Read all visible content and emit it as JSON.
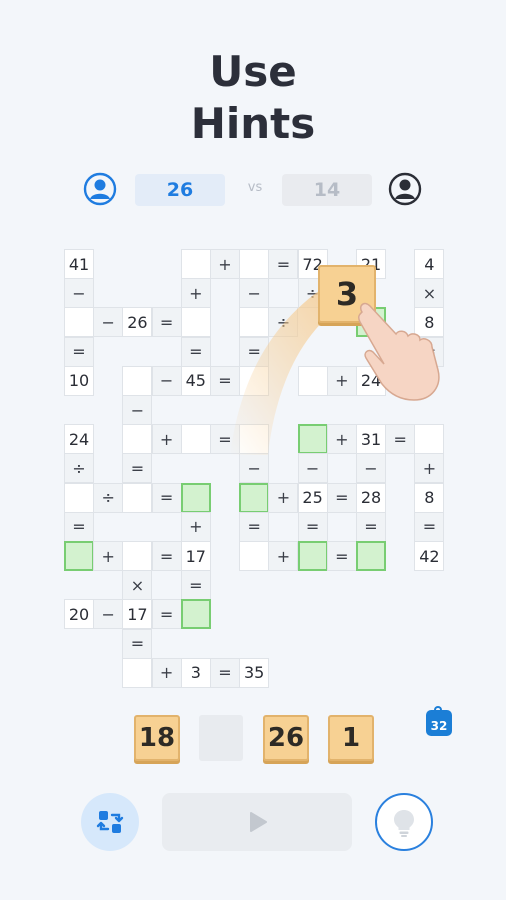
{
  "title": {
    "line1": "Use",
    "line2": "Hints"
  },
  "players": {
    "left_score": "26",
    "vs_label": "vs",
    "right_score": "14",
    "left_avatar_icon": "user-circle-icon",
    "right_avatar_icon": "user-circle-icon"
  },
  "colors": {
    "accent": "#1f7ce0",
    "tile": "#f7d193",
    "green_cell": "#d3f2cf",
    "background": "#f3f6fa"
  },
  "board": {
    "cells": [
      {
        "row": 0,
        "col": 0,
        "text": "41",
        "type": "num"
      },
      {
        "row": 0,
        "col": 4,
        "text": "",
        "type": "num"
      },
      {
        "row": 0,
        "col": 5,
        "text": "+",
        "type": "op"
      },
      {
        "row": 0,
        "col": 6,
        "text": "",
        "type": "num"
      },
      {
        "row": 0,
        "col": 7,
        "text": "=",
        "type": "op"
      },
      {
        "row": 0,
        "col": 8,
        "text": "72",
        "type": "num"
      },
      {
        "row": 0,
        "col": 10,
        "text": "21",
        "type": "num"
      },
      {
        "row": 0,
        "col": 12,
        "text": "4",
        "type": "num"
      },
      {
        "row": 1,
        "col": 0,
        "text": "−",
        "type": "op"
      },
      {
        "row": 1,
        "col": 4,
        "text": "+",
        "type": "op"
      },
      {
        "row": 1,
        "col": 6,
        "text": "−",
        "type": "op"
      },
      {
        "row": 1,
        "col": 8,
        "text": "÷",
        "type": "op"
      },
      {
        "row": 1,
        "col": 12,
        "text": "×",
        "type": "op"
      },
      {
        "row": 2,
        "col": 0,
        "text": "",
        "type": "num"
      },
      {
        "row": 2,
        "col": 1,
        "text": "−",
        "type": "op"
      },
      {
        "row": 2,
        "col": 2,
        "text": "26",
        "type": "num"
      },
      {
        "row": 2,
        "col": 3,
        "text": "=",
        "type": "op"
      },
      {
        "row": 2,
        "col": 4,
        "text": "",
        "type": "num"
      },
      {
        "row": 2,
        "col": 6,
        "text": "",
        "type": "num"
      },
      {
        "row": 2,
        "col": 7,
        "text": "÷",
        "type": "op"
      },
      {
        "row": 2,
        "col": 10,
        "text": "",
        "type": "green"
      },
      {
        "row": 2,
        "col": 12,
        "text": "8",
        "type": "num"
      },
      {
        "row": 3,
        "col": 0,
        "text": "=",
        "type": "op"
      },
      {
        "row": 3,
        "col": 4,
        "text": "=",
        "type": "op"
      },
      {
        "row": 3,
        "col": 6,
        "text": "=",
        "type": "op"
      },
      {
        "row": 3,
        "col": 12,
        "text": "=",
        "type": "op"
      },
      {
        "row": 4,
        "col": 0,
        "text": "10",
        "type": "num"
      },
      {
        "row": 4,
        "col": 2,
        "text": "",
        "type": "num"
      },
      {
        "row": 4,
        "col": 3,
        "text": "−",
        "type": "op"
      },
      {
        "row": 4,
        "col": 4,
        "text": "45",
        "type": "num"
      },
      {
        "row": 4,
        "col": 5,
        "text": "=",
        "type": "op"
      },
      {
        "row": 4,
        "col": 6,
        "text": "",
        "type": "num"
      },
      {
        "row": 4,
        "col": 8,
        "text": "",
        "type": "num"
      },
      {
        "row": 4,
        "col": 9,
        "text": "+",
        "type": "op"
      },
      {
        "row": 4,
        "col": 10,
        "text": "24",
        "type": "num"
      },
      {
        "row": 5,
        "col": 2,
        "text": "−",
        "type": "op"
      },
      {
        "row": 6,
        "col": 0,
        "text": "24",
        "type": "num"
      },
      {
        "row": 6,
        "col": 2,
        "text": "",
        "type": "num"
      },
      {
        "row": 6,
        "col": 3,
        "text": "+",
        "type": "op"
      },
      {
        "row": 6,
        "col": 4,
        "text": "",
        "type": "num"
      },
      {
        "row": 6,
        "col": 5,
        "text": "=",
        "type": "op"
      },
      {
        "row": 6,
        "col": 6,
        "text": "",
        "type": "num"
      },
      {
        "row": 6,
        "col": 8,
        "text": "",
        "type": "green"
      },
      {
        "row": 6,
        "col": 9,
        "text": "+",
        "type": "op"
      },
      {
        "row": 6,
        "col": 10,
        "text": "31",
        "type": "num"
      },
      {
        "row": 6,
        "col": 11,
        "text": "=",
        "type": "op"
      },
      {
        "row": 6,
        "col": 12,
        "text": "",
        "type": "num"
      },
      {
        "row": 7,
        "col": 0,
        "text": "÷",
        "type": "op"
      },
      {
        "row": 7,
        "col": 2,
        "text": "=",
        "type": "op"
      },
      {
        "row": 7,
        "col": 6,
        "text": "−",
        "type": "op"
      },
      {
        "row": 7,
        "col": 8,
        "text": "−",
        "type": "op"
      },
      {
        "row": 7,
        "col": 10,
        "text": "−",
        "type": "op"
      },
      {
        "row": 7,
        "col": 12,
        "text": "+",
        "type": "op"
      },
      {
        "row": 8,
        "col": 0,
        "text": "",
        "type": "num"
      },
      {
        "row": 8,
        "col": 1,
        "text": "÷",
        "type": "op"
      },
      {
        "row": 8,
        "col": 2,
        "text": "",
        "type": "num"
      },
      {
        "row": 8,
        "col": 3,
        "text": "=",
        "type": "op"
      },
      {
        "row": 8,
        "col": 4,
        "text": "",
        "type": "green"
      },
      {
        "row": 8,
        "col": 6,
        "text": "",
        "type": "green"
      },
      {
        "row": 8,
        "col": 7,
        "text": "+",
        "type": "op"
      },
      {
        "row": 8,
        "col": 8,
        "text": "25",
        "type": "num"
      },
      {
        "row": 8,
        "col": 9,
        "text": "=",
        "type": "op"
      },
      {
        "row": 8,
        "col": 10,
        "text": "28",
        "type": "num"
      },
      {
        "row": 8,
        "col": 12,
        "text": "8",
        "type": "num"
      },
      {
        "row": 9,
        "col": 0,
        "text": "=",
        "type": "op"
      },
      {
        "row": 9,
        "col": 4,
        "text": "+",
        "type": "op"
      },
      {
        "row": 9,
        "col": 6,
        "text": "=",
        "type": "op"
      },
      {
        "row": 9,
        "col": 8,
        "text": "=",
        "type": "op"
      },
      {
        "row": 9,
        "col": 10,
        "text": "=",
        "type": "op"
      },
      {
        "row": 9,
        "col": 12,
        "text": "=",
        "type": "op"
      },
      {
        "row": 10,
        "col": 0,
        "text": "",
        "type": "green"
      },
      {
        "row": 10,
        "col": 1,
        "text": "+",
        "type": "op"
      },
      {
        "row": 10,
        "col": 2,
        "text": "",
        "type": "num"
      },
      {
        "row": 10,
        "col": 3,
        "text": "=",
        "type": "op"
      },
      {
        "row": 10,
        "col": 4,
        "text": "17",
        "type": "num"
      },
      {
        "row": 10,
        "col": 6,
        "text": "",
        "type": "num"
      },
      {
        "row": 10,
        "col": 7,
        "text": "+",
        "type": "op"
      },
      {
        "row": 10,
        "col": 8,
        "text": "",
        "type": "green"
      },
      {
        "row": 10,
        "col": 9,
        "text": "=",
        "type": "op"
      },
      {
        "row": 10,
        "col": 10,
        "text": "",
        "type": "green"
      },
      {
        "row": 10,
        "col": 12,
        "text": "42",
        "type": "num"
      },
      {
        "row": 11,
        "col": 2,
        "text": "×",
        "type": "op"
      },
      {
        "row": 11,
        "col": 4,
        "text": "=",
        "type": "op"
      },
      {
        "row": 12,
        "col": 0,
        "text": "20",
        "type": "num"
      },
      {
        "row": 12,
        "col": 1,
        "text": "−",
        "type": "op"
      },
      {
        "row": 12,
        "col": 2,
        "text": "17",
        "type": "num"
      },
      {
        "row": 12,
        "col": 3,
        "text": "=",
        "type": "op"
      },
      {
        "row": 12,
        "col": 4,
        "text": "",
        "type": "green"
      },
      {
        "row": 13,
        "col": 2,
        "text": "=",
        "type": "op"
      },
      {
        "row": 14,
        "col": 2,
        "text": "",
        "type": "num"
      },
      {
        "row": 14,
        "col": 3,
        "text": "+",
        "type": "op"
      },
      {
        "row": 14,
        "col": 4,
        "text": "3",
        "type": "num"
      },
      {
        "row": 14,
        "col": 5,
        "text": "=",
        "type": "op"
      },
      {
        "row": 14,
        "col": 6,
        "text": "35",
        "type": "num"
      }
    ]
  },
  "dragging_tile": {
    "value": "3"
  },
  "hand_icon": "pointing-hand-icon",
  "tray": {
    "tiles": [
      "18",
      "",
      "26",
      "1"
    ],
    "badge_count": "32",
    "badge_icon": "shopping-bag-icon"
  },
  "controls": {
    "swap_icon": "swap-arrows-icon",
    "play_icon": "play-icon",
    "hint_icon": "lightbulb-icon"
  }
}
